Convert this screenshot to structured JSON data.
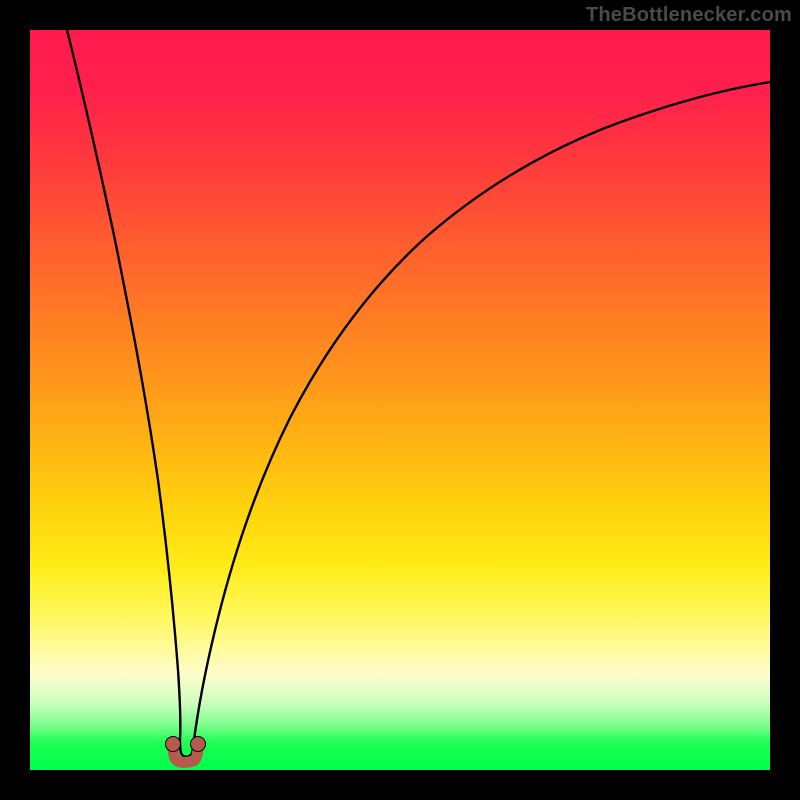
{
  "attribution": "TheBottlenecker.com",
  "colors": {
    "frame": "#000000",
    "gradient_top": "#ff1a4e",
    "gradient_mid": "#fff85a",
    "gradient_bottom": "#00ff4c",
    "curve_stroke": "#000000",
    "marker_fill": "#b55a4d",
    "marker_stroke": "#000000",
    "attribution_text": "#4a4a4a"
  },
  "chart_data": {
    "type": "line",
    "title": "",
    "xlabel": "",
    "ylabel": "",
    "xlim": [
      0,
      100
    ],
    "ylim": [
      0,
      100
    ],
    "grid": false,
    "legend": false,
    "series": [
      {
        "name": "bottleneck-curve",
        "x": [
          0,
          2,
          4,
          6,
          8,
          10,
          12,
          14,
          16,
          18,
          19,
          20,
          21,
          22,
          23,
          24,
          26,
          28,
          30,
          33,
          36,
          40,
          45,
          50,
          55,
          60,
          65,
          70,
          75,
          80,
          85,
          90,
          95,
          100
        ],
        "values": [
          100,
          90,
          80,
          71,
          62,
          53,
          44,
          35,
          24,
          12,
          6,
          2,
          2,
          4,
          8,
          13,
          22,
          30,
          36,
          44,
          50,
          56,
          62,
          67,
          71,
          74,
          77,
          79,
          81,
          83,
          84,
          85,
          86,
          87
        ]
      }
    ],
    "annotations": [
      {
        "name": "min-marker-left",
        "x": 19.2,
        "y": 2,
        "shape": "dot",
        "color": "#b55a4d"
      },
      {
        "name": "min-marker-right",
        "x": 21.3,
        "y": 2,
        "shape": "dot",
        "color": "#b55a4d"
      },
      {
        "name": "min-arc-bottom",
        "x": 20.25,
        "y": 1.0,
        "shape": "arc",
        "color": "#b55a4d"
      }
    ],
    "notes": "Curve represents bottleneck percentage (y, 0–100) vs. a swept hardware parameter (x, 0–100). Minimum (~2%) occurs near x≈20. Background gradient encodes y: green near 0 (no bottleneck) through yellow/orange to red near 100 (severe bottleneck)."
  }
}
